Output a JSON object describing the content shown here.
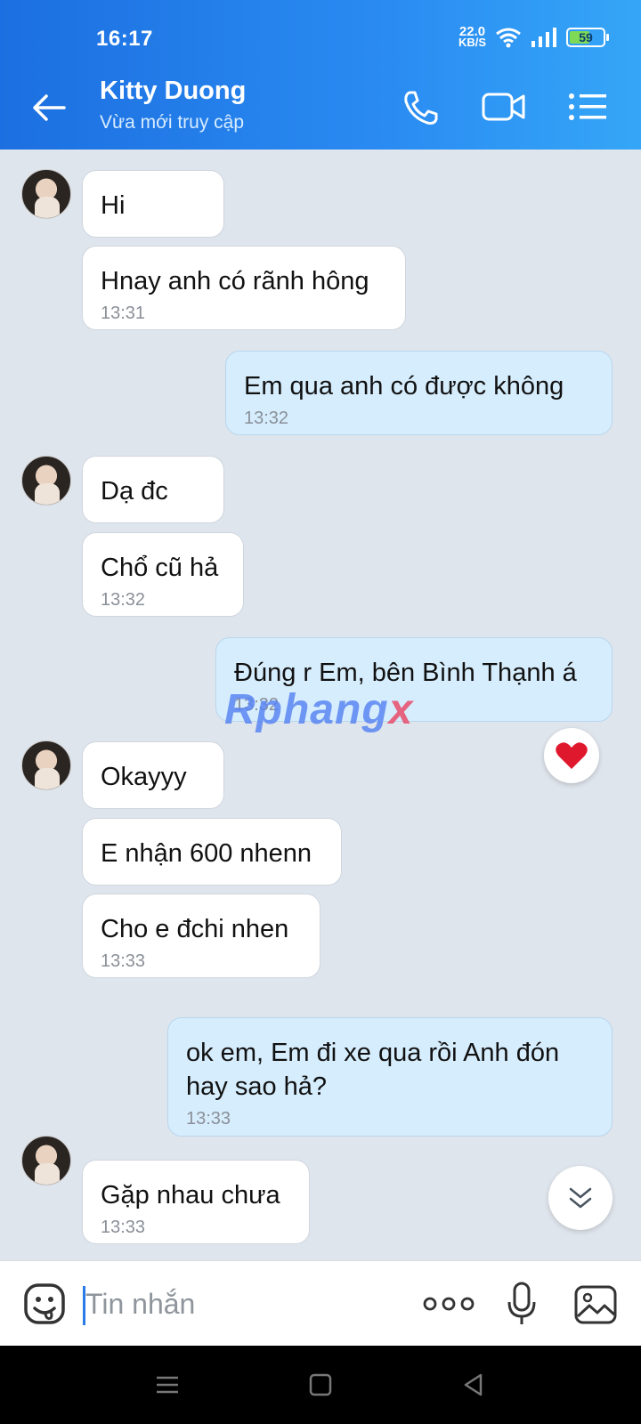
{
  "status_bar": {
    "time": "16:17",
    "net_speed": "22.0",
    "net_unit": "KB/S",
    "battery": "59"
  },
  "header": {
    "contact_name": "Kitty Duong",
    "contact_status": "Vừa mới truy cập"
  },
  "messages": [
    {
      "dir": "in",
      "text": "Hi",
      "time": ""
    },
    {
      "dir": "in",
      "text": "Hnay anh có rãnh hông",
      "time": "13:31"
    },
    {
      "dir": "out",
      "text": "Em qua anh có được không",
      "time": "13:32"
    },
    {
      "dir": "in",
      "text": "Dạ đc",
      "time": ""
    },
    {
      "dir": "in",
      "text": "Chổ cũ hả",
      "time": "13:32"
    },
    {
      "dir": "out",
      "text": "Đúng r Em, bên Bình Thạnh á",
      "time": "13:32",
      "reaction": "heart"
    },
    {
      "dir": "in",
      "text": "Okayyy",
      "time": ""
    },
    {
      "dir": "in",
      "text": "E nhận 600 nhenn",
      "time": ""
    },
    {
      "dir": "in",
      "text": "Cho e đchi nhen",
      "time": "13:33"
    },
    {
      "dir": "out",
      "text": "ok em, Em đi xe qua rồi Anh đón hay sao hả?",
      "time": "13:33"
    },
    {
      "dir": "in",
      "text": "Gặp nhau chưa",
      "time": "13:33"
    }
  ],
  "watermark": {
    "main": "Rphang",
    "accent": "x"
  },
  "input": {
    "placeholder": "Tin nhắn"
  },
  "colors": {
    "header": "#2a8bf2",
    "outgoing_bubble": "#d6edfd",
    "chat_bg": "#dfe5ec",
    "reaction": "#e0182d"
  }
}
